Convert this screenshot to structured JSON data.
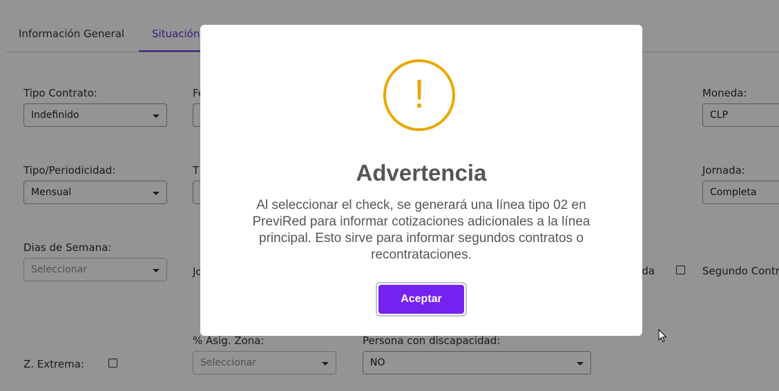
{
  "tabs": [
    {
      "label": "Información General"
    },
    {
      "label": "Situación"
    }
  ],
  "form": {
    "tipo_contrato": {
      "label": "Tipo Contrato:",
      "value": "Indefinido"
    },
    "fe_label": "Fe",
    "moneda": {
      "label": "Moneda:",
      "value": "CLP"
    },
    "tipo_periodicidad": {
      "label": "Tipo/Periodicidad:",
      "value": "Mensual"
    },
    "t_label": "T",
    "jornada": {
      "label": "Jornada:",
      "value": "Completa"
    },
    "dias_semana": {
      "label": "Dias de Semana:",
      "placeholder": "Seleccionar"
    },
    "jo_label": "Jo",
    "rida_label": "rida",
    "segundo_contrato_label": "Segundo Contr",
    "z_extrema_label": "Z. Extrema:",
    "asig_zona": {
      "label": "% Asig. Zona:",
      "placeholder": "Seleccionar"
    },
    "discapacidad": {
      "label": "Persona con discapacidad:",
      "value": "NO"
    }
  },
  "modal": {
    "icon": "warning-exclamation-icon",
    "icon_glyph": "!",
    "title": "Advertencia",
    "message_lines": [
      "Al seleccionar el check, se generará una línea tipo 02 en",
      "PreviRed para informar cotizaciones adicionales a la línea",
      "principal. Esto sirve para informar segundos contratos o",
      "recontrataciones."
    ],
    "accept_label": "Aceptar"
  },
  "colors": {
    "accent": "#6b2fe0",
    "button": "#7422f0",
    "warning": "#e8a800"
  }
}
